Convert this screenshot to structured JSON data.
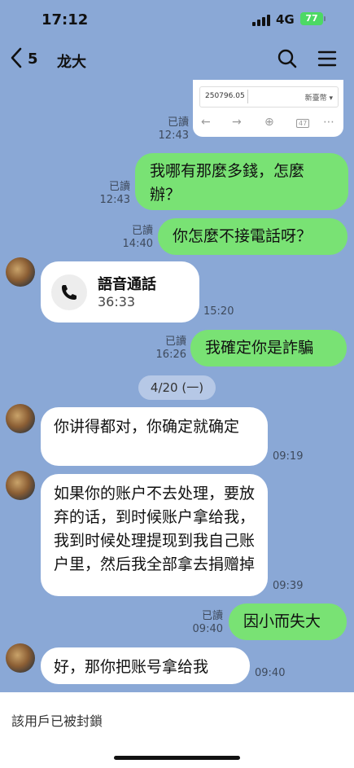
{
  "status": {
    "time": "17:12",
    "network": "4G",
    "battery": "77"
  },
  "header": {
    "back_count": "5",
    "title": "龙大",
    "icons": [
      "search-icon",
      "menu-icon"
    ]
  },
  "screenshot_preview": {
    "amount": "250796.05",
    "dropdown": "新臺幣",
    "tabs_count": "47"
  },
  "messages": [
    {
      "side": "me",
      "read": "已讀",
      "time": "12:43",
      "type": "image"
    },
    {
      "side": "me",
      "read": "已讀",
      "time": "12:43",
      "text": "我哪有那麼多錢，怎麼辦？"
    },
    {
      "side": "me",
      "read": "已讀",
      "time": "14:40",
      "text": "你怎麼不接電話呀？"
    },
    {
      "side": "them",
      "time": "15:20",
      "type": "voice_call",
      "title": "語音通話",
      "duration": "36:33"
    },
    {
      "side": "me",
      "read": "已讀",
      "time": "16:26",
      "text": "我確定你是詐騙"
    },
    {
      "type": "date",
      "text": "4/20 (一)"
    },
    {
      "side": "them",
      "time": "09:19",
      "text": "你讲得都对，你确定就确定"
    },
    {
      "side": "them",
      "time": "09:39",
      "text": "如果你的账户不去处理，要放弃的话，到时候账户拿给我，我到时候处理提现到我自己账户里，然后我全部拿去捐赠掉"
    },
    {
      "side": "me",
      "read": "已讀",
      "time": "09:40",
      "text": "因小而失大"
    },
    {
      "side": "them",
      "time": "09:40",
      "text": "好，那你把账号拿给我"
    }
  ],
  "footer": {
    "notice": "該用戶已被封鎖"
  },
  "colors": {
    "background": "#8aa8d6",
    "my_bubble": "#79e274",
    "their_bubble": "#ffffff"
  }
}
